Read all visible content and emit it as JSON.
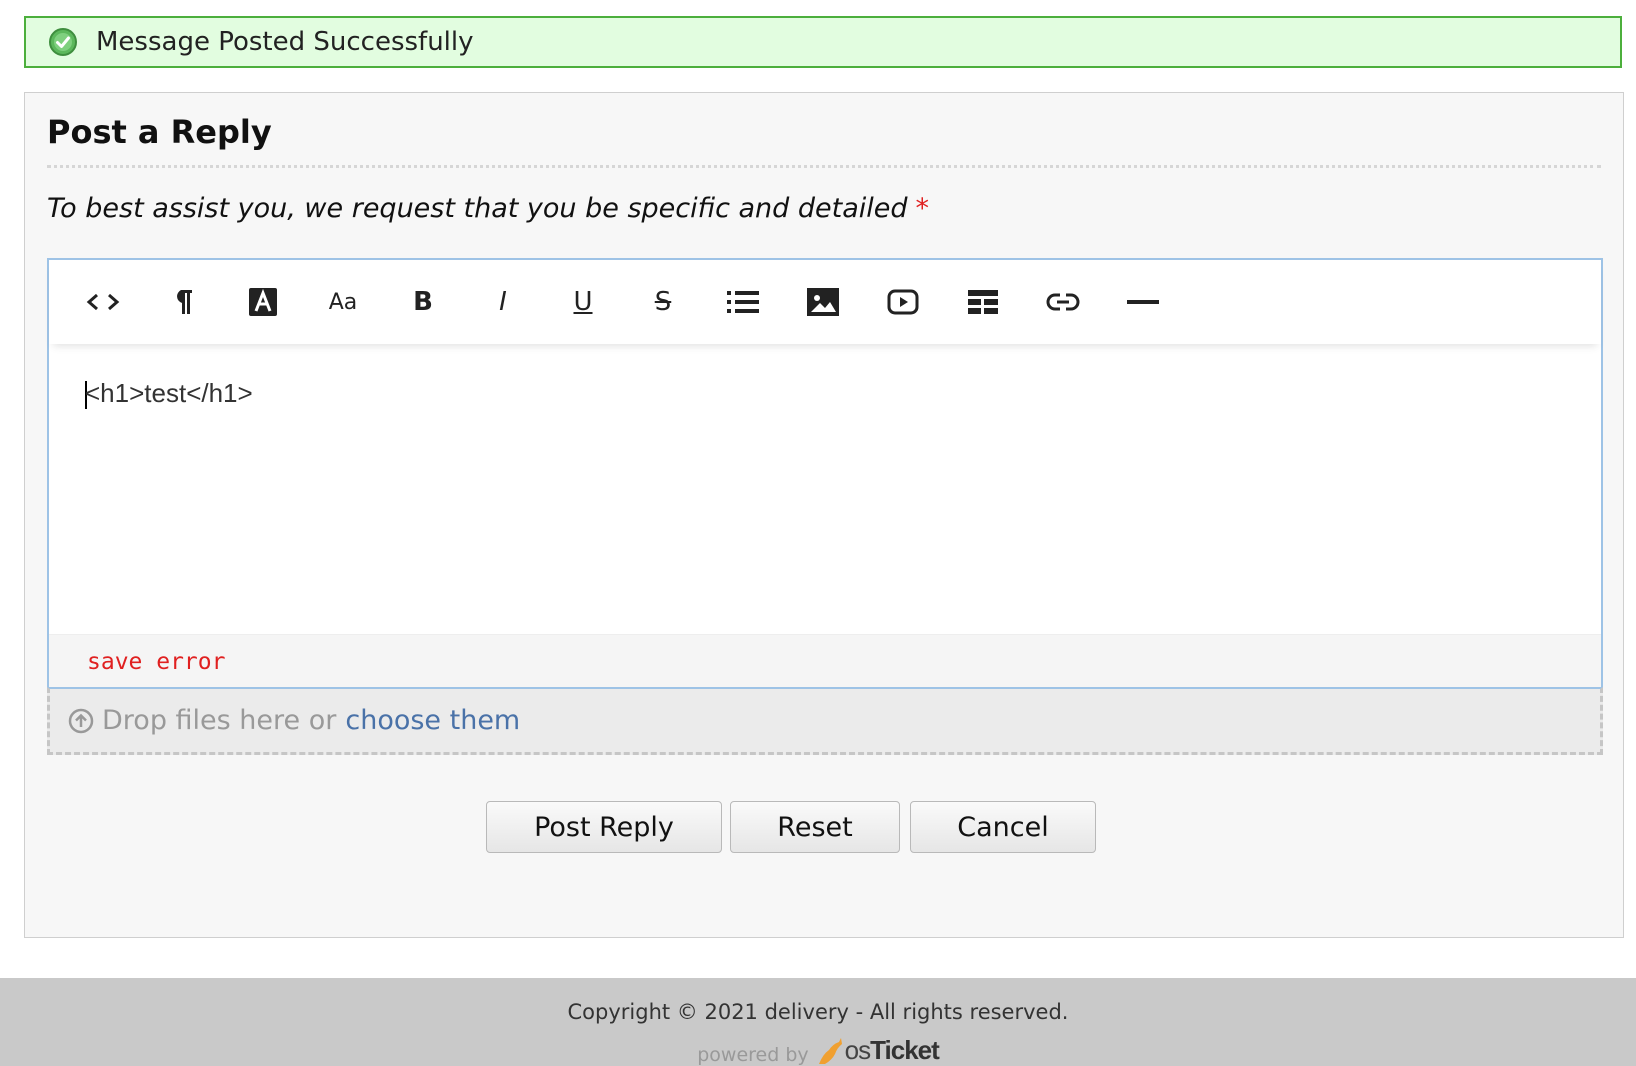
{
  "banner": {
    "message": "Message Posted Successfully",
    "icon": "check-circle-icon"
  },
  "reply": {
    "title": "Post a Reply",
    "instructions": "To best assist you, we request that you be specific and detailed",
    "required_marker": "*"
  },
  "toolbar": {
    "items": [
      {
        "name": "html-source",
        "icon": "code-icon"
      },
      {
        "name": "format",
        "icon": "paragraph-icon"
      },
      {
        "name": "font-color",
        "icon": "font-color-icon"
      },
      {
        "name": "font-size",
        "icon": "font-size-icon",
        "label": "Aa"
      },
      {
        "name": "bold",
        "icon": "bold-icon",
        "label": "B"
      },
      {
        "name": "italic",
        "icon": "italic-icon",
        "label": "I"
      },
      {
        "name": "underline",
        "icon": "underline-icon",
        "label": "U"
      },
      {
        "name": "strikethrough",
        "icon": "strikethrough-icon",
        "label": "S"
      },
      {
        "name": "lists",
        "icon": "list-icon"
      },
      {
        "name": "image",
        "icon": "image-icon"
      },
      {
        "name": "video",
        "icon": "video-icon"
      },
      {
        "name": "table",
        "icon": "table-icon"
      },
      {
        "name": "link",
        "icon": "link-icon"
      },
      {
        "name": "horizontal-rule",
        "icon": "horizontal-rule-icon"
      }
    ]
  },
  "editor": {
    "content": "<h1>test</h1>",
    "status_error": "save error"
  },
  "dropzone": {
    "text": "Drop files here or",
    "link": "choose them",
    "icon": "upload-icon"
  },
  "buttons": {
    "post": "Post Reply",
    "reset": "Reset",
    "cancel": "Cancel"
  },
  "footer": {
    "copyright": "Copyright © 2021 delivery - All rights reserved.",
    "powered_by": "powered by",
    "logo_os": "os",
    "logo_ticket": "Ticket"
  },
  "colors": {
    "success_bg": "#e2fde0",
    "success_border": "#4caf3c",
    "required": "#e02020",
    "link": "#4a72a8",
    "editor_border": "#9ec3e6",
    "footer_bg": "#c9c9c9"
  }
}
